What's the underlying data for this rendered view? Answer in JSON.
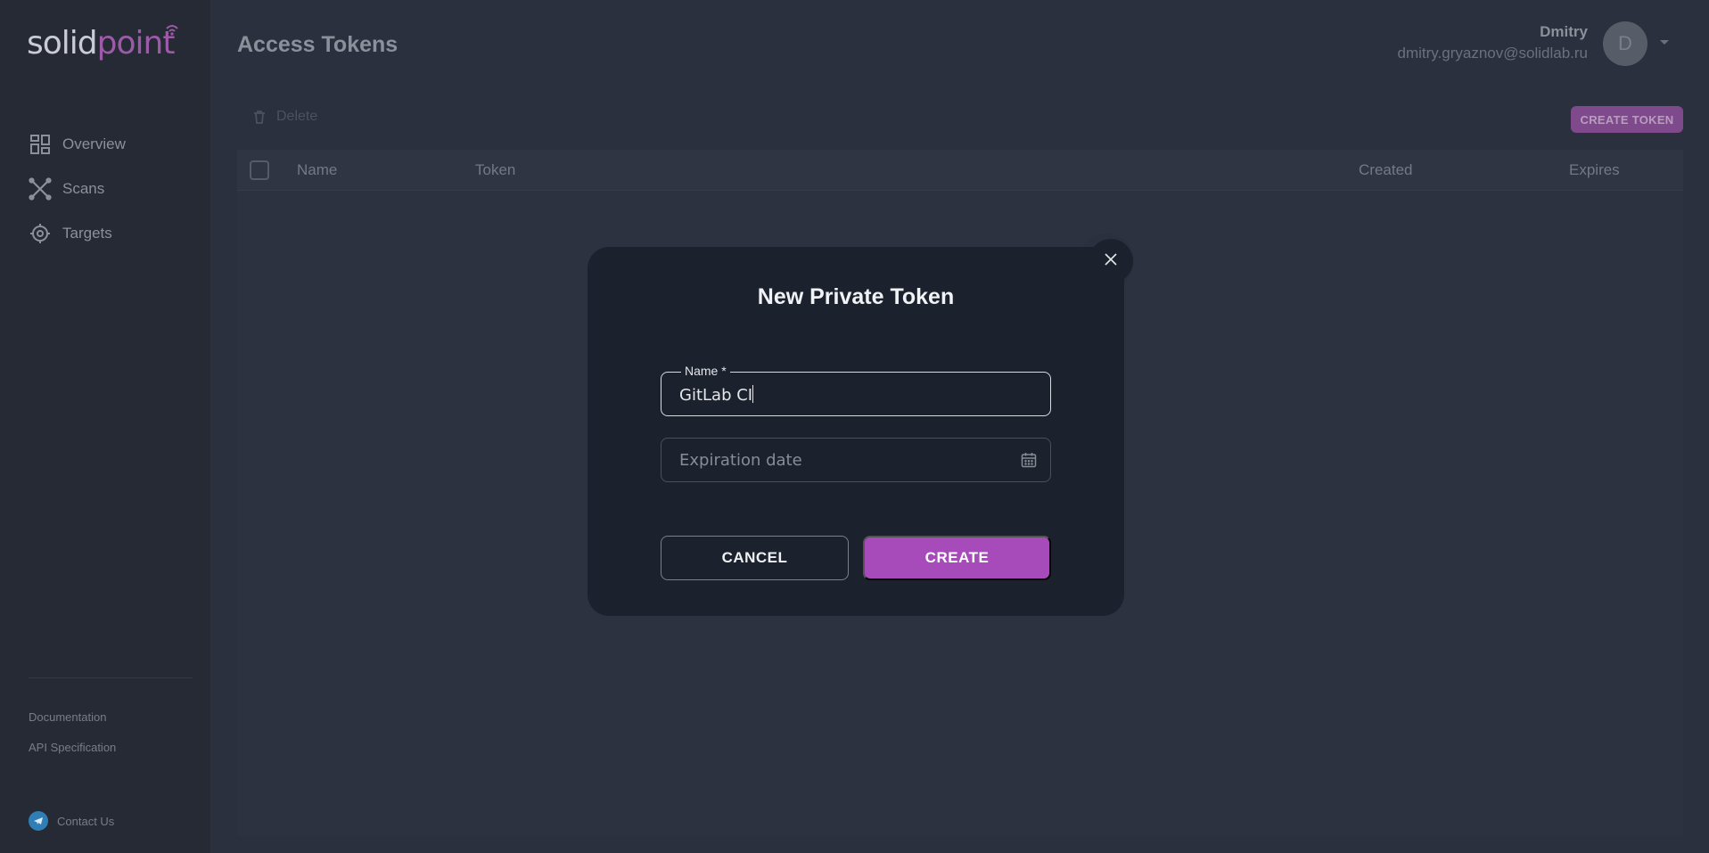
{
  "app": {
    "logo_main": "solid",
    "logo_accent": "point"
  },
  "sidebar": {
    "items": [
      {
        "label": "Overview",
        "icon": "grid-icon"
      },
      {
        "label": "Scans",
        "icon": "scans-icon"
      },
      {
        "label": "Targets",
        "icon": "target-icon"
      }
    ],
    "footer": {
      "documentation": "Documentation",
      "api_spec": "API Specification",
      "contact": "Contact Us"
    }
  },
  "header": {
    "title": "Access Tokens",
    "user_name": "Dmitry",
    "user_email": "dmitry.gryaznov@solidlab.ru",
    "avatar_initial": "D"
  },
  "toolbar": {
    "delete_label": "Delete",
    "create_token_label": "CREATE TOKEN"
  },
  "table": {
    "columns": [
      "Name",
      "Token",
      "Created",
      "Expires"
    ]
  },
  "modal": {
    "title": "New Private Token",
    "name_label": "Name *",
    "name_value": "GitLab CI",
    "date_placeholder": "Expiration date",
    "cancel_label": "CANCEL",
    "create_label": "CREATE"
  },
  "colors": {
    "accent": "#a74bbb",
    "modal_bg": "#1c222d",
    "page_bg": "#2a303d"
  }
}
